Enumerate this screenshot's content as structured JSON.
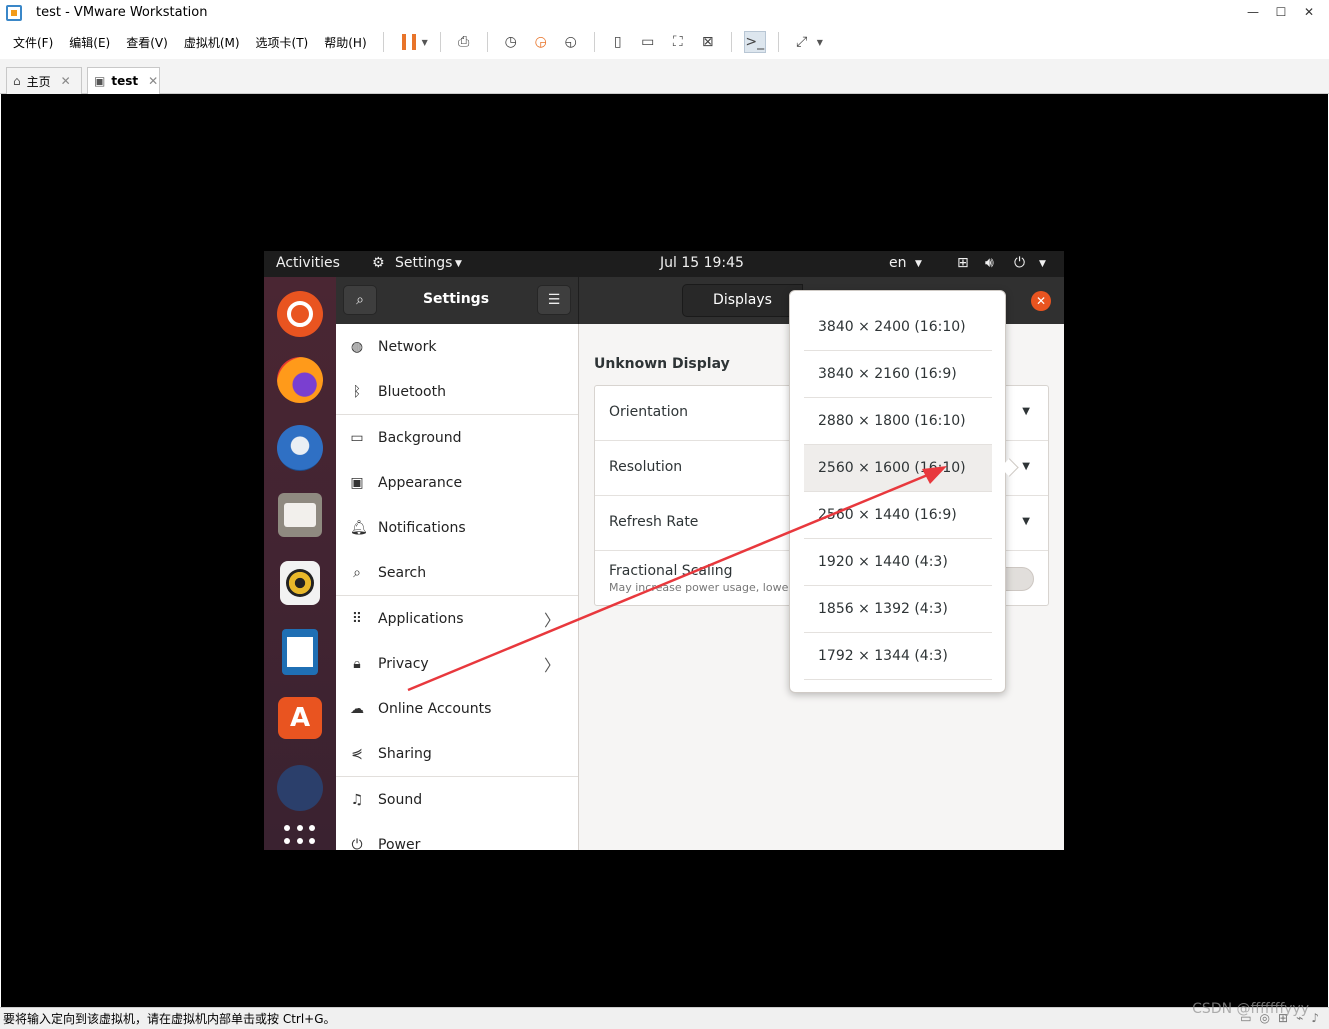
{
  "vmware": {
    "title": "test - VMware Workstation",
    "window_buttons": [
      "—",
      "☐",
      "✕"
    ],
    "menu": [
      "文件(F)",
      "编辑(E)",
      "查看(V)",
      "虚拟机(M)",
      "选项卡(T)",
      "帮助(H)"
    ],
    "tabs": [
      {
        "label": "主页",
        "close": "✕"
      },
      {
        "label": "test",
        "close": "✕"
      }
    ],
    "status_text": "要将输入定向到该虚拟机，请在虚拟机内部单击或按 Ctrl+G。",
    "watermark": "CSDN @fffffffyyy"
  },
  "ubuntu": {
    "topbar": {
      "activities": "Activities",
      "app_menu": "Settings",
      "clock": "Jul 15  19:45",
      "input_method": "en"
    },
    "settings": {
      "title": "Settings",
      "header_tab": "Displays",
      "sidebar": [
        {
          "label": "Network",
          "icon": "network-icon"
        },
        {
          "label": "Bluetooth",
          "icon": "bluetooth-icon"
        },
        {
          "label": "Background",
          "icon": "background-icon"
        },
        {
          "label": "Appearance",
          "icon": "appearance-icon"
        },
        {
          "label": "Notifications",
          "icon": "bell-icon"
        },
        {
          "label": "Search",
          "icon": "search-icon"
        },
        {
          "label": "Applications",
          "icon": "apps-grid-icon",
          "has_submenu": true
        },
        {
          "label": "Privacy",
          "icon": "lock-icon",
          "has_submenu": true
        },
        {
          "label": "Online Accounts",
          "icon": "cloud-icon"
        },
        {
          "label": "Sharing",
          "icon": "share-icon"
        },
        {
          "label": "Sound",
          "icon": "music-note-icon"
        },
        {
          "label": "Power",
          "icon": "power-icon"
        }
      ],
      "display_name": "Unknown Display",
      "rows": [
        {
          "label": "Orientation"
        },
        {
          "label": "Resolution"
        },
        {
          "label": "Refresh Rate"
        },
        {
          "label": "Fractional Scaling",
          "sub": "May increase power usage, lower"
        }
      ],
      "resolutions": [
        "3840 × 2400 (16:10)",
        "3840 × 2160 (16:9)",
        "2880 × 1800 (16:10)",
        "2560 × 1600 (16:10)",
        "2560 × 1440 (16:9)",
        "1920 × 1440 (4:3)",
        "1856 × 1392 (4:3)",
        "1792 × 1344 (4:3)"
      ],
      "highlighted_resolution_index": 3
    }
  },
  "colors": {
    "ubuntu_orange": "#e95420",
    "annotation_arrow": "#e8383d",
    "vmware_pause": "#e8742a"
  }
}
